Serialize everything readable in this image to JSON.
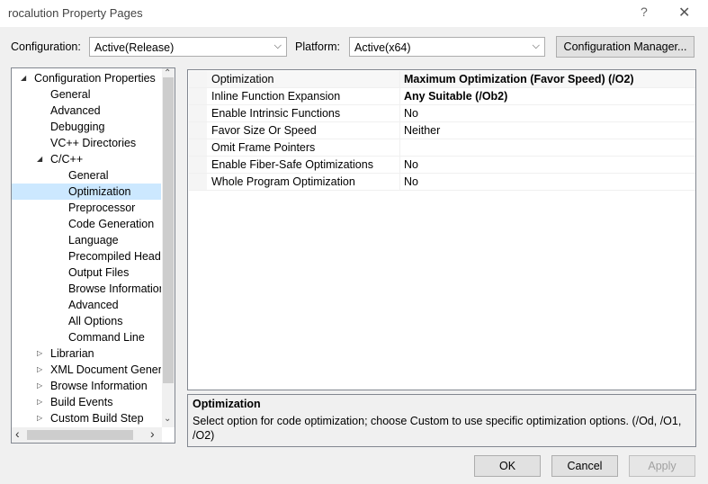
{
  "window": {
    "title": "rocalution Property Pages",
    "help_glyph": "?",
    "close_glyph": "✕"
  },
  "header": {
    "configuration_label": "Configuration:",
    "configuration_value": "Active(Release)",
    "platform_label": "Platform:",
    "platform_value": "Active(x64)",
    "config_manager_label": "Configuration Manager..."
  },
  "tree": {
    "items": [
      {
        "label": "Configuration Properties",
        "expander": "◢",
        "level": 0
      },
      {
        "label": "General",
        "expander": "",
        "level": 1
      },
      {
        "label": "Advanced",
        "expander": "",
        "level": 1
      },
      {
        "label": "Debugging",
        "expander": "",
        "level": 1
      },
      {
        "label": "VC++ Directories",
        "expander": "",
        "level": 1
      },
      {
        "label": "C/C++",
        "expander": "◢",
        "level": 1
      },
      {
        "label": "General",
        "expander": "",
        "level": 2
      },
      {
        "label": "Optimization",
        "expander": "",
        "level": 2,
        "selected": true
      },
      {
        "label": "Preprocessor",
        "expander": "",
        "level": 2
      },
      {
        "label": "Code Generation",
        "expander": "",
        "level": 2
      },
      {
        "label": "Language",
        "expander": "",
        "level": 2
      },
      {
        "label": "Precompiled Heade",
        "expander": "",
        "level": 2
      },
      {
        "label": "Output Files",
        "expander": "",
        "level": 2
      },
      {
        "label": "Browse Information",
        "expander": "",
        "level": 2
      },
      {
        "label": "Advanced",
        "expander": "",
        "level": 2
      },
      {
        "label": "All Options",
        "expander": "",
        "level": 2
      },
      {
        "label": "Command Line",
        "expander": "",
        "level": 2
      },
      {
        "label": "Librarian",
        "expander": "▷",
        "level": 1
      },
      {
        "label": "XML Document Genera",
        "expander": "▷",
        "level": 1
      },
      {
        "label": "Browse Information",
        "expander": "▷",
        "level": 1
      },
      {
        "label": "Build Events",
        "expander": "▷",
        "level": 1
      },
      {
        "label": "Custom Build Step",
        "expander": "▷",
        "level": 1
      }
    ],
    "scroll_up": "⌃",
    "scroll_down": "⌄",
    "scroll_left": "‹",
    "scroll_right": "›"
  },
  "properties": [
    {
      "name": "Optimization",
      "value": "Maximum Optimization (Favor Speed) (/O2)",
      "bold": true,
      "selected": true
    },
    {
      "name": "Inline Function Expansion",
      "value": "Any Suitable (/Ob2)",
      "bold": true
    },
    {
      "name": "Enable Intrinsic Functions",
      "value": "No",
      "bold": false
    },
    {
      "name": "Favor Size Or Speed",
      "value": "Neither",
      "bold": false
    },
    {
      "name": "Omit Frame Pointers",
      "value": "",
      "bold": false
    },
    {
      "name": "Enable Fiber-Safe Optimizations",
      "value": "No",
      "bold": false
    },
    {
      "name": "Whole Program Optimization",
      "value": "No",
      "bold": false
    }
  ],
  "description": {
    "title": "Optimization",
    "text": "Select option for code optimization; choose Custom to use specific optimization options.     (/Od, /O1, /O2)"
  },
  "buttons": {
    "ok": "OK",
    "cancel": "Cancel",
    "apply": "Apply"
  }
}
